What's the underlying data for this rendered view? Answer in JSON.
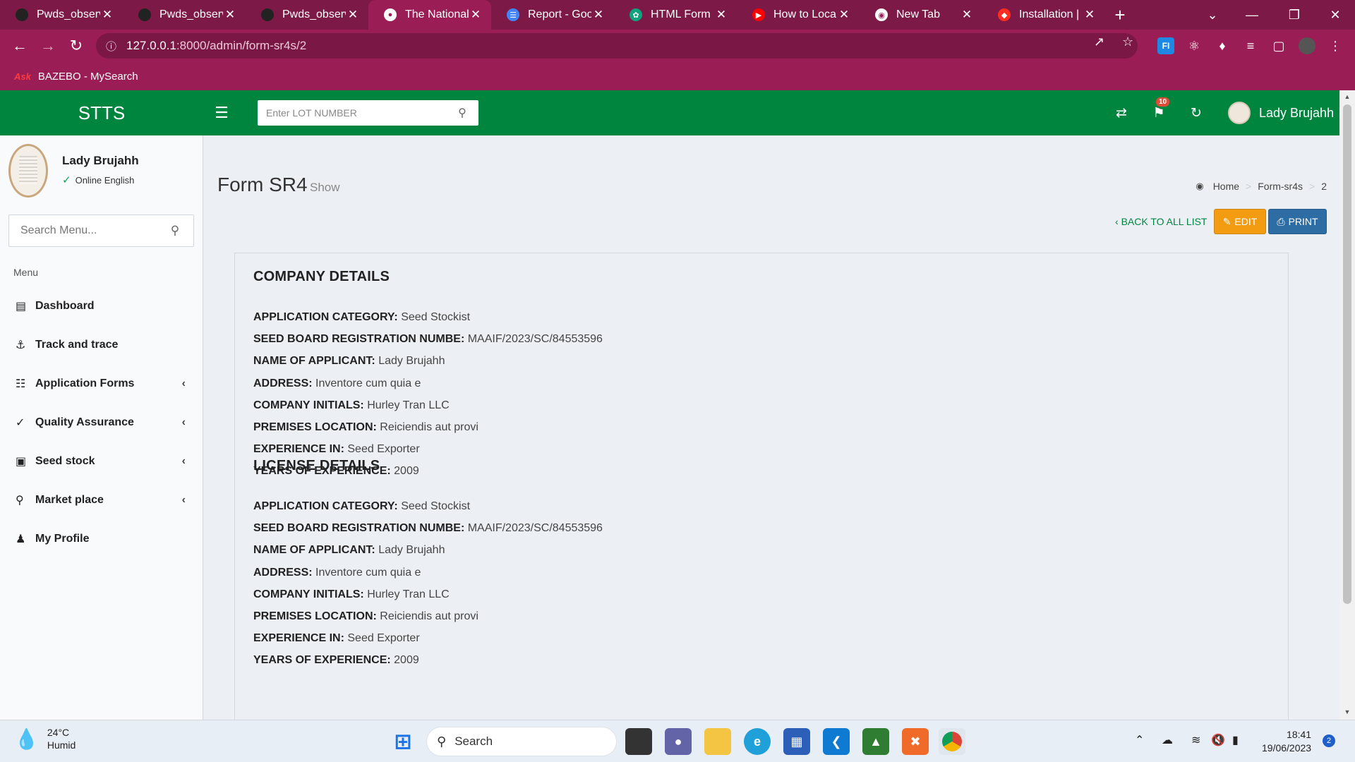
{
  "browser": {
    "tabs": [
      {
        "title": "Pwds_observa",
        "icon": "github-icon"
      },
      {
        "title": "Pwds_observa",
        "icon": "github-icon"
      },
      {
        "title": "Pwds_observa",
        "icon": "github-icon"
      },
      {
        "title": "The National S",
        "icon": "globe-icon"
      },
      {
        "title": "Report - Goog",
        "icon": "google-docs-icon"
      },
      {
        "title": "HTML Form Pr",
        "icon": "chatgpt-icon"
      },
      {
        "title": "How to Locali",
        "icon": "youtube-icon"
      },
      {
        "title": "New Tab",
        "icon": "chrome-icon"
      },
      {
        "title": "Installation | L",
        "icon": "laravel-icon"
      }
    ],
    "active_tab": 3,
    "url_host": "127.0.0.1",
    "url_path": ":8000/admin/form-sr4s/2",
    "bookmark": "BAZEBO - MySearch",
    "theme_color": "#9b1d55"
  },
  "header": {
    "logo": "STTS",
    "search_placeholder": "Enter LOT NUMBER",
    "notification_count": "10",
    "user_name": "Lady Brujahh",
    "brand_color": "#00853f"
  },
  "sidebar": {
    "user_name": "Lady Brujahh",
    "status": "Online English",
    "search_placeholder": "Search Menu...",
    "menu_header": "Menu",
    "items": [
      {
        "label": "Dashboard",
        "icon": "bar-chart-icon",
        "has_children": false
      },
      {
        "label": "Track and trace",
        "icon": "anchor-icon",
        "has_children": false
      },
      {
        "label": "Application Forms",
        "icon": "form-icon",
        "has_children": true
      },
      {
        "label": "Quality Assurance",
        "icon": "check-icon",
        "has_children": true
      },
      {
        "label": "Seed stock",
        "icon": "archive-icon",
        "has_children": true
      },
      {
        "label": "Market place",
        "icon": "cart-icon",
        "has_children": true
      },
      {
        "label": "My Profile",
        "icon": "user-icon",
        "has_children": false
      }
    ]
  },
  "page": {
    "title": "Form SR4",
    "subtitle": "Show",
    "breadcrumb": [
      "Home",
      "Form-sr4s",
      "2"
    ],
    "back_link": "BACK TO ALL LIST",
    "edit_label": "EDIT",
    "print_label": "PRINT"
  },
  "sections": [
    {
      "heading": "COMPANY DETAILS",
      "fields": [
        {
          "label": "APPLICATION CATEGORY:",
          "value": "Seed Stockist"
        },
        {
          "label": "SEED BOARD REGISTRATION NUMBE:",
          "value": "MAAIF/2023/SC/84553596"
        },
        {
          "label": "NAME OF APPLICANT:",
          "value": "Lady Brujahh"
        },
        {
          "label": "ADDRESS:",
          "value": "Inventore cum quia e"
        },
        {
          "label": "COMPANY INITIALS:",
          "value": "Hurley Tran LLC"
        },
        {
          "label": "PREMISES LOCATION:",
          "value": "Reiciendis aut provi"
        },
        {
          "label": "EXPERIENCE IN:",
          "value": "Seed Exporter"
        },
        {
          "label": "YEARS OF EXPERIENCE:",
          "value": "2009"
        }
      ]
    },
    {
      "heading": "LICENSE DETAILS",
      "fields": [
        {
          "label": "APPLICATION CATEGORY:",
          "value": "Seed Stockist"
        },
        {
          "label": "SEED BOARD REGISTRATION NUMBE:",
          "value": "MAAIF/2023/SC/84553596"
        },
        {
          "label": "NAME OF APPLICANT:",
          "value": "Lady Brujahh"
        },
        {
          "label": "ADDRESS:",
          "value": "Inventore cum quia e"
        },
        {
          "label": "COMPANY INITIALS:",
          "value": "Hurley Tran LLC"
        },
        {
          "label": "PREMISES LOCATION:",
          "value": "Reiciendis aut provi"
        },
        {
          "label": "EXPERIENCE IN:",
          "value": "Seed Exporter"
        },
        {
          "label": "YEARS OF EXPERIENCE:",
          "value": "2009"
        }
      ]
    }
  ],
  "taskbar": {
    "temperature": "24°C",
    "weather": "Humid",
    "search_label": "Search",
    "time": "18:41",
    "date": "19/06/2023",
    "notification_count": "2"
  }
}
